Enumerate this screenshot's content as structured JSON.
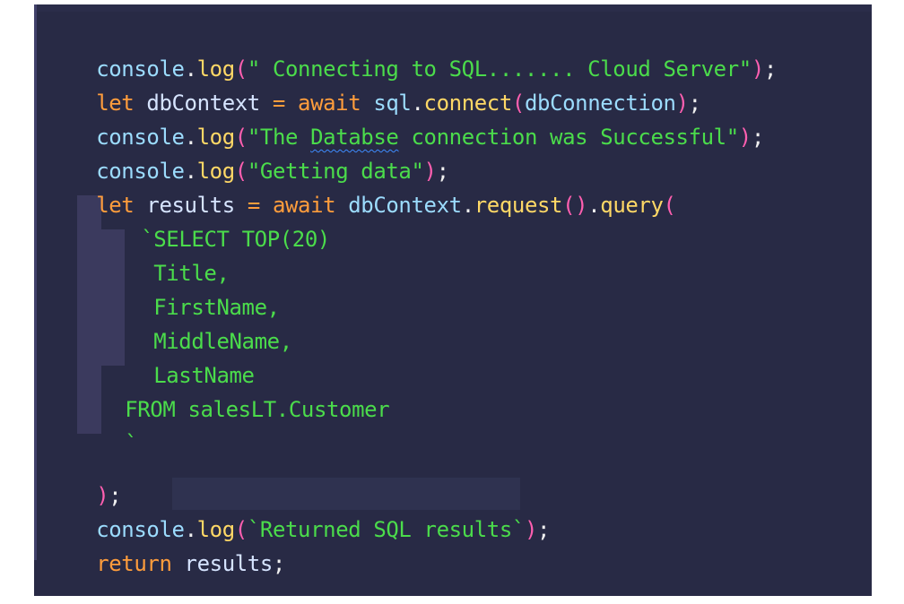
{
  "editor": {
    "lines": [
      {
        "id": "l1",
        "tokens": [
          "console",
          ".",
          "log",
          "(",
          "\" Connecting to SQL....... Cloud Server\"",
          ")",
          ";"
        ]
      },
      {
        "id": "l2",
        "tokens": [
          "let",
          " dbContext ",
          "=",
          " ",
          "await",
          " sql",
          ".",
          "connect",
          "(",
          "dbConnection",
          ")",
          ";"
        ]
      },
      {
        "id": "l3",
        "tokens": [
          "console",
          ".",
          "log",
          "(",
          "\"The ",
          "Databse",
          " connection was Successful\"",
          ")",
          ";"
        ]
      },
      {
        "id": "l4",
        "tokens": [
          "console",
          ".",
          "log",
          "(",
          "\"Getting data\"",
          ")",
          ";"
        ]
      },
      {
        "id": "l5",
        "tokens": [
          "let",
          " results ",
          "=",
          " ",
          "await",
          " dbContext",
          ".",
          "request",
          "()",
          ".",
          "query",
          "("
        ]
      },
      {
        "id": "l6",
        "tokens": [
          "`SELECT TOP(20)"
        ]
      },
      {
        "id": "l7",
        "tokens": [
          "Title,"
        ]
      },
      {
        "id": "l8",
        "tokens": [
          "FirstName,"
        ]
      },
      {
        "id": "l9",
        "tokens": [
          "MiddleName,"
        ]
      },
      {
        "id": "l10",
        "tokens": [
          "LastName"
        ]
      },
      {
        "id": "l11",
        "tokens": [
          "FROM salesLT.Customer"
        ]
      },
      {
        "id": "l12",
        "tokens": [
          "`"
        ]
      },
      {
        "id": "l13",
        "tokens": []
      },
      {
        "id": "l14",
        "tokens": [
          ")",
          ";"
        ]
      },
      {
        "id": "l15",
        "tokens": [
          "console",
          ".",
          "log",
          "(",
          "`Returned SQL results`",
          ")",
          ";"
        ]
      },
      {
        "id": "l16",
        "tokens": [
          "return",
          " results",
          ";"
        ]
      }
    ]
  },
  "colors": {
    "background": "#282a45",
    "keyword": "#ff9d3c",
    "function": "#ffd866",
    "string": "#4bdc4b",
    "paren": "#ff5fb0",
    "identifier": "#9cdcfe"
  }
}
